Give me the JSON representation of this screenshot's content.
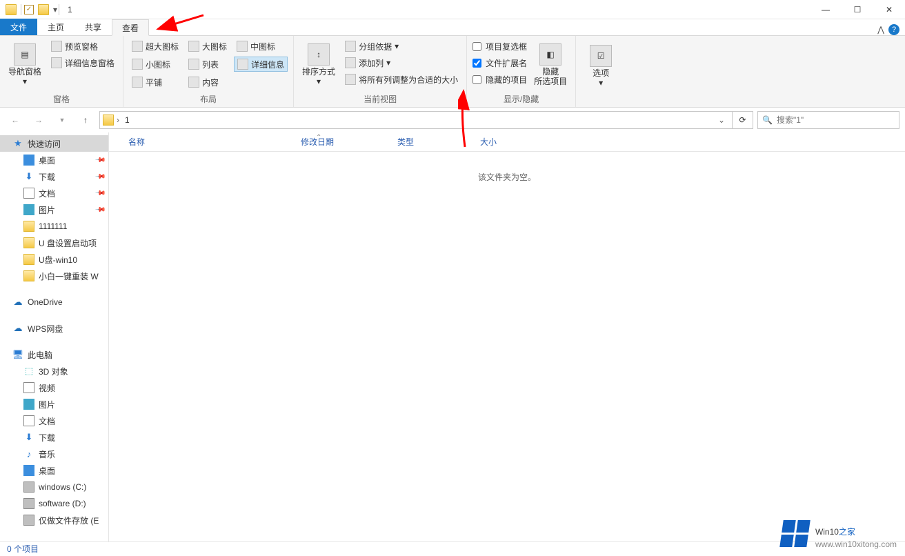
{
  "window": {
    "title": "1"
  },
  "tabs": {
    "file": "文件",
    "home": "主页",
    "share": "共享",
    "view": "查看"
  },
  "ribbon": {
    "panes_group": "窗格",
    "nav_pane": "导航窗格",
    "preview_pane": "预览窗格",
    "details_pane": "详细信息窗格",
    "layout_group": "布局",
    "extra_large_icons": "超大图标",
    "large_icons": "大图标",
    "medium_icons": "中图标",
    "small_icons": "小图标",
    "list": "列表",
    "details": "详细信息",
    "tiles": "平铺",
    "content": "内容",
    "currentview_group": "当前视图",
    "sort_by": "排序方式",
    "group_by": "分组依据",
    "add_columns": "添加列",
    "size_all_columns": "将所有列调整为合适的大小",
    "showhide_group": "显示/隐藏",
    "item_checkboxes": "项目复选框",
    "file_ext": "文件扩展名",
    "hidden_items": "隐藏的项目",
    "hide_selected_top": "隐藏",
    "hide_selected_bottom": "所选项目",
    "options": "选项"
  },
  "address": {
    "crumb": "1"
  },
  "search": {
    "placeholder": "搜索\"1\""
  },
  "columns": {
    "name": "名称",
    "date": "修改日期",
    "type": "类型",
    "size": "大小"
  },
  "empty": "该文件夹为空。",
  "sidebar": {
    "quick": "快速访问",
    "desktop": "桌面",
    "downloads": "下载",
    "documents": "文档",
    "pictures": "图片",
    "f1": "1111111",
    "f2": "U 盘设置启动项",
    "f3": "U盘-win10",
    "f4": "小白一键重装 W",
    "onedrive": "OneDrive",
    "wps": "WPS网盘",
    "thispc": "此电脑",
    "obj3d": "3D 对象",
    "videos": "视频",
    "pictures2": "图片",
    "documents2": "文档",
    "downloads2": "下载",
    "music": "音乐",
    "desktop2": "桌面",
    "driveC": "windows (C:)",
    "driveD": "software (D:)",
    "driveE": "仅做文件存放 (E"
  },
  "status": {
    "items": "0 个项目"
  },
  "watermark": {
    "brand_main": "Win10",
    "brand_accent": "之家",
    "url": "www.win10xitong.com"
  }
}
